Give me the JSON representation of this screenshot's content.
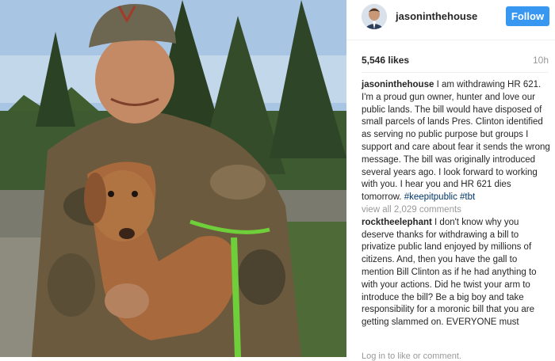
{
  "post": {
    "username": "jasoninthehouse",
    "follow_label": "Follow",
    "likes": "5,546 likes",
    "time": "10h",
    "caption": {
      "username": "jasoninthehouse",
      "text": "I am withdrawing HR 621. I'm a proud gun owner, hunter and love our public lands. The bill would have disposed of small parcels of lands Pres. Clinton identified as serving no public purpose but groups I support and care about fear it sends the wrong message. The bill was originally introduced several years ago. I look forward to working with you. I hear you and HR 621 dies tomorrow.",
      "hashtags": "#keepitpublic #tbt"
    },
    "view_all": "view all 2,029 comments",
    "comments": [
      {
        "username": "rocktheelephant",
        "text": "I don't know why you deserve thanks for withdrawing a bill to privatize public land enjoyed by millions of citizens. And, then you have the gall to mention Bill Clinton as if he had anything to with your actions. Did he twist your arm to introduce the bill? Be a big boy and take responsibility for a moronic bill that you are getting slammed on. EVERYONE must"
      }
    ],
    "footer_hint": "Log in to like or comment."
  },
  "icons": {
    "avatar": "user-avatar",
    "photo": "post-photo"
  },
  "colors": {
    "follow_button": "#3897f0",
    "hashtag": "#003569",
    "muted": "#999999"
  }
}
